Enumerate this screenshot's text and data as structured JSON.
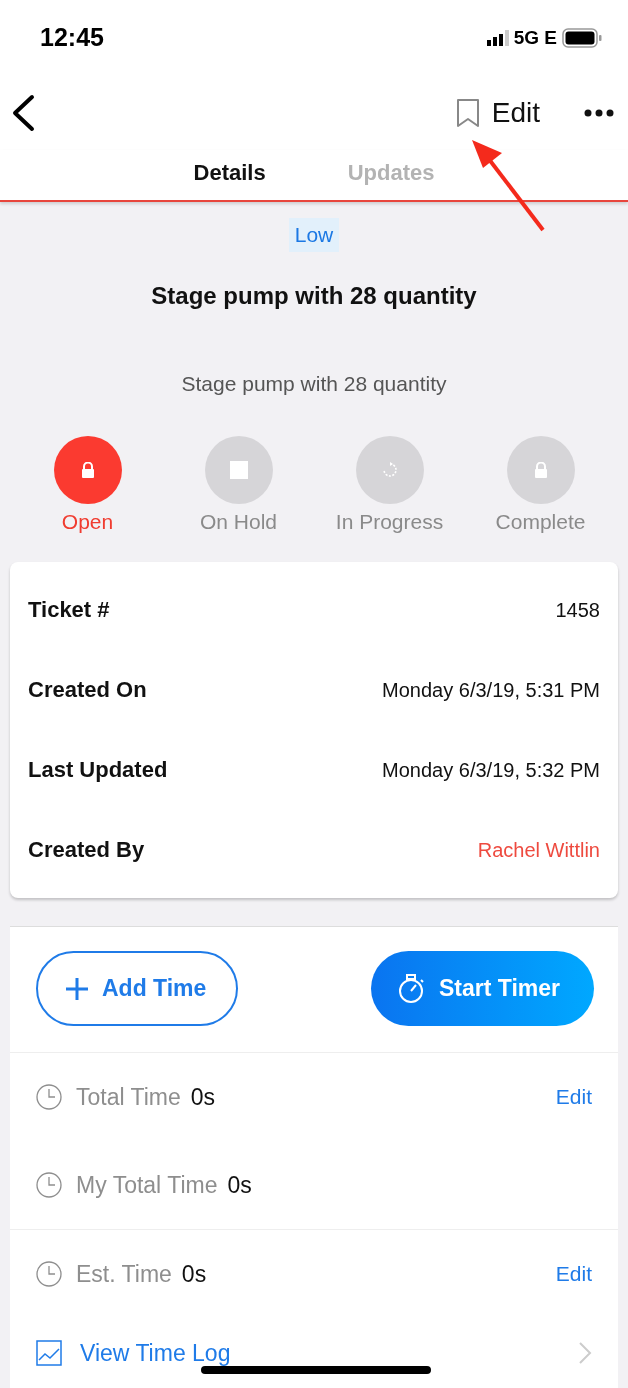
{
  "status_bar": {
    "time": "12:45",
    "network": "5G E"
  },
  "nav": {
    "action": "Edit"
  },
  "tabs": [
    {
      "label": "Details",
      "selected": true
    },
    {
      "label": "Updates",
      "selected": false
    }
  ],
  "priority": "Low",
  "title": "Stage pump with 28 quantity",
  "description": "Stage pump with 28 quantity",
  "statuses": [
    {
      "label": "Open",
      "kind": "lock",
      "selected": true
    },
    {
      "label": "On Hold",
      "kind": "stop",
      "selected": false
    },
    {
      "label": "In Progress",
      "kind": "progress",
      "selected": false
    },
    {
      "label": "Complete",
      "kind": "lock",
      "selected": false
    }
  ],
  "details": [
    {
      "label": "Ticket #",
      "value": "1458",
      "kind": "text"
    },
    {
      "label": "Created On",
      "value": "Monday 6/3/19, 5:31 PM",
      "kind": "text"
    },
    {
      "label": "Last Updated",
      "value": "Monday 6/3/19, 5:32 PM",
      "kind": "text"
    },
    {
      "label": "Created By",
      "value": "Rachel Wittlin",
      "kind": "link"
    }
  ],
  "buttons": [
    {
      "label": "Add Time",
      "kind": "outline"
    },
    {
      "label": "Start Timer",
      "kind": "filled"
    }
  ],
  "time_rows": [
    {
      "label": "Total Time",
      "value": "0s",
      "action": "Edit"
    },
    {
      "label": "My Total Time",
      "value": "0s"
    },
    {
      "label": "Est. Time",
      "value": "0s",
      "action": "Edit"
    }
  ],
  "time_log": {
    "label": "View Time Log"
  }
}
